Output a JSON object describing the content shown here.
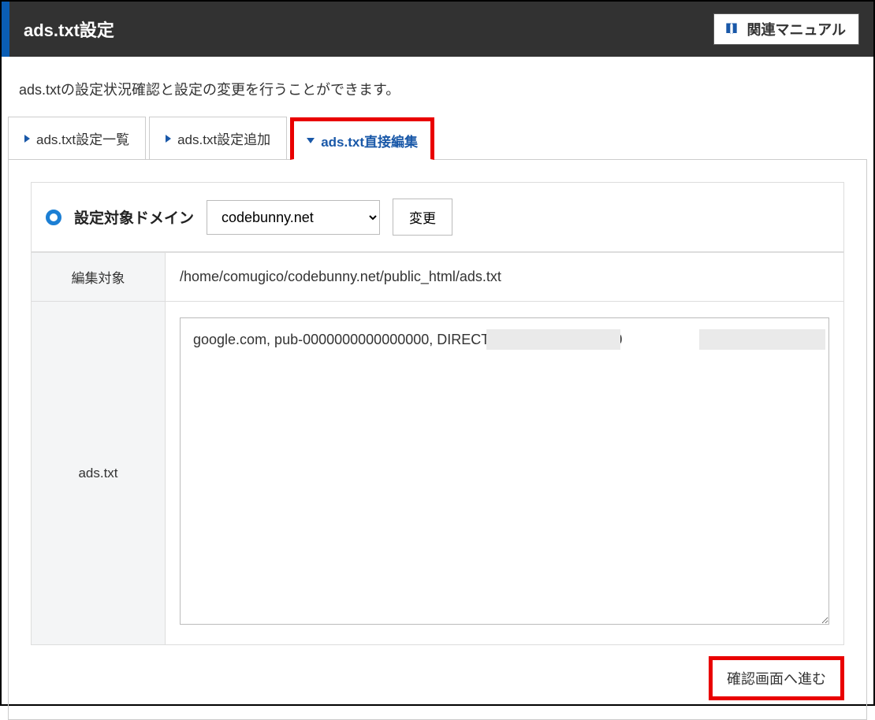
{
  "header": {
    "title": "ads.txt設定",
    "manual_label": "関連マニュアル"
  },
  "description": "ads.txtの設定状況確認と設定の変更を行うことができます。",
  "tabs": [
    {
      "label": "ads.txt設定一覧",
      "active": false
    },
    {
      "label": "ads.txt設定追加",
      "active": false
    },
    {
      "label": "ads.txt直接編集",
      "active": true
    }
  ],
  "domain_section": {
    "label": "設定対象ドメイン",
    "selected": "codebunny.net",
    "change_label": "変更"
  },
  "form": {
    "target_label": "編集対象",
    "target_value": "/home/comugico/codebunny.net/public_html/ads.txt",
    "textarea_label": "ads.txt",
    "textarea_value": "google.com, pub-0000000000000000, DIRECT, 0000000000000000"
  },
  "confirm_label": "確認画面へ進む"
}
